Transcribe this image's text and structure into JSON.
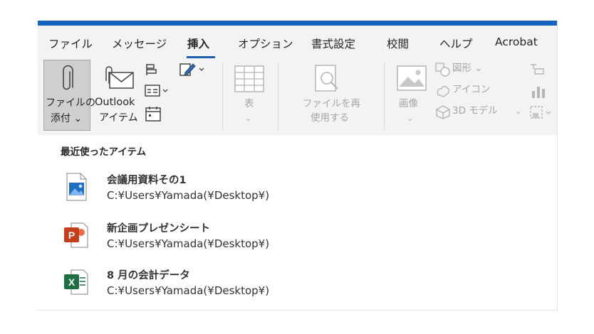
{
  "tabs": [
    {
      "label": "ファイル"
    },
    {
      "label": "メッセージ"
    },
    {
      "label": "挿入"
    },
    {
      "label": "オプション"
    },
    {
      "label": "書式設定"
    },
    {
      "label": "校閲"
    },
    {
      "label": "ヘルプ"
    },
    {
      "label": "Acrobat"
    }
  ],
  "ribbon": {
    "attach_line1": "ファイルの",
    "attach_line2": "添付 ⌄",
    "outlook_line1": "Outlook",
    "outlook_line2": "アイテム",
    "table_label": "表",
    "table_chevron": "⌄",
    "reuse_line1": "ファイルを再",
    "reuse_line2": "使用する",
    "image_label": "画像",
    "image_chevron": "⌄",
    "shapes_label": "図形 ⌄",
    "icons_label": "アイコン",
    "models_label": "3D モデル",
    "models_chevron": "⌄"
  },
  "menu": {
    "title": "最近使ったアイテム",
    "items": [
      {
        "name": "会議用資料その1",
        "path": "C:¥Users¥Yamada(¥Desktop¥)",
        "type": "image"
      },
      {
        "name": "新企画プレゼンシート",
        "path": "C:¥Users¥Yamada(¥Desktop¥)",
        "type": "powerpoint"
      },
      {
        "name": "8 月の会計データ",
        "path": "C:¥Users¥Yamada(¥Desktop¥)",
        "type": "excel"
      }
    ]
  },
  "colors": {
    "accent": "#1565c0",
    "ribbon_bg": "#f3f3f3",
    "attach_selected_bg": "#cfcfcf",
    "powerpoint": "#c43e1c",
    "excel": "#1d6f42",
    "image_blue": "#1e6fc4",
    "disabled_text": "#a6a6a6"
  }
}
